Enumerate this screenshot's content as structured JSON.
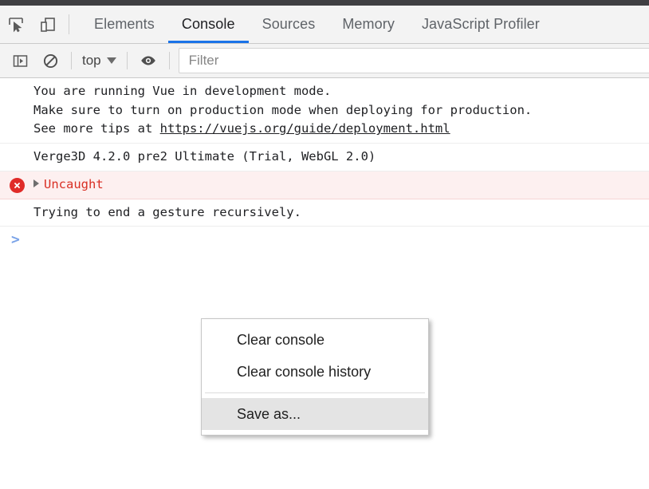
{
  "toolbar": {
    "inspect_icon": "inspect-cursor-icon",
    "device_icon": "device-toolbar-icon",
    "tabs": [
      {
        "label": "Elements",
        "active": false
      },
      {
        "label": "Console",
        "active": true
      },
      {
        "label": "Sources",
        "active": false
      },
      {
        "label": "Memory",
        "active": false
      },
      {
        "label": "JavaScript Profiler",
        "active": false
      }
    ]
  },
  "filterbar": {
    "sidebar_icon": "console-sidebar-icon",
    "clear_icon": "clear-console-icon",
    "context_value": "top",
    "eye_icon": "live-expression-eye-icon",
    "filter_placeholder": "Filter"
  },
  "console": {
    "messages": [
      {
        "type": "log",
        "lines": [
          "You are running Vue in development mode.",
          "Make sure to turn on production mode when deploying for production.",
          "See more tips at "
        ],
        "link": "https://vuejs.org/guide/deployment.html"
      },
      {
        "type": "log",
        "lines": [
          "Verge3D 4.2.0 pre2 Ultimate (Trial, WebGL 2.0)"
        ]
      },
      {
        "type": "error",
        "lines": [
          "Uncaught"
        ]
      },
      {
        "type": "log",
        "lines": [
          "Trying to end a gesture recursively."
        ]
      }
    ],
    "prompt_symbol": ">"
  },
  "context_menu": {
    "items": [
      {
        "label": "Clear console",
        "highlighted": false,
        "separator_after": false
      },
      {
        "label": "Clear console history",
        "highlighted": false,
        "separator_after": true
      },
      {
        "label": "Save as...",
        "highlighted": true,
        "separator_after": false
      }
    ]
  },
  "colors": {
    "accent": "#1a73e8",
    "error_text": "#d93025",
    "error_bg": "#fdf0f0",
    "chrome_bg": "#f3f3f3",
    "menu_highlight": "#e4e4e4"
  }
}
